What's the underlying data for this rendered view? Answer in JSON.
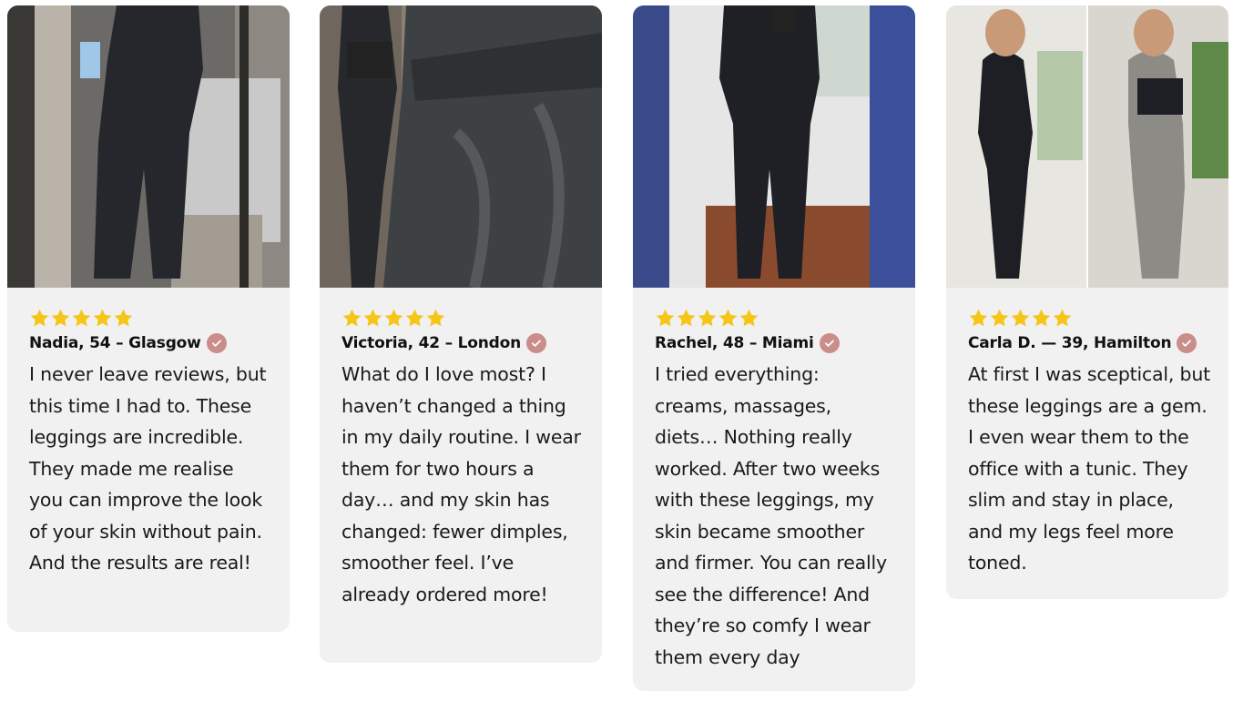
{
  "colors": {
    "card_bg": "#f1f1f1",
    "star": "#f5c518",
    "verified_badge": "#c98e8a",
    "text": "#1a1a1a"
  },
  "rating_max": 5,
  "reviews": [
    {
      "rating": 5,
      "author": "Nadia, 54 – Glasgow",
      "text": "I never leave reviews, but this time I had to. These leggings are incredible. They made me realise you can improve the look of your skin without pain. And the results are real!",
      "photo": "mirror-selfie-black-leggings-back-view"
    },
    {
      "rating": 5,
      "author": "Victoria, 42 – London",
      "text": "What do I love most? I haven’t changed a thing in my daily routine. I wear them for two hours a day… and my skin has changed: fewer dimples, smoother feel. I’ve already ordered more!",
      "photo": "close-up-textured-grey-leggings"
    },
    {
      "rating": 5,
      "author": "Rachel, 48 – Miami",
      "text": "I tried everything: creams, massages, diets… Nothing really worked. After two weeks with these leggings, my skin became smoother and firmer. You can really see the difference! And they’re so comfy I wear them every day",
      "photo": "mirror-selfie-black-outfit-hallway"
    },
    {
      "rating": 5,
      "author": "Carla D. — 39, Hamilton",
      "text": "At first I was sceptical, but these leggings are a gem. I even wear them to the office with a tunic. They slim and stay in place, and my legs feel more toned.",
      "photo": "before-after-side-by-side-selfies"
    }
  ]
}
